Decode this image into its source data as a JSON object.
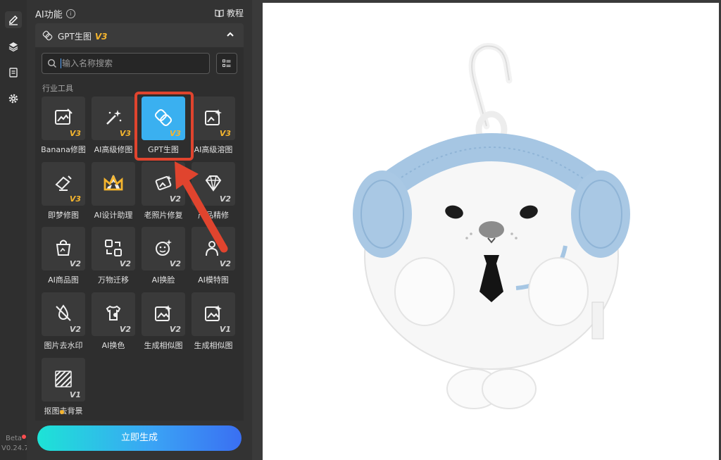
{
  "rail": {
    "items": [
      {
        "icon": "edit-icon",
        "active": true
      },
      {
        "icon": "layers-icon",
        "active": false
      },
      {
        "icon": "document-icon",
        "active": false
      },
      {
        "icon": "gear-icon",
        "active": false
      }
    ],
    "beta_label": "Beta",
    "version": "V0.24.7"
  },
  "panel": {
    "title": "AI功能",
    "tutorial_label": "教程",
    "section": {
      "label": "GPT生图",
      "version": "V3"
    },
    "search": {
      "placeholder": "输入名称搜索"
    },
    "category_label": "行业工具",
    "tools": [
      {
        "label": "Banana修图",
        "version": "V3",
        "gold": true,
        "icon": "image-edit-icon"
      },
      {
        "label": "AI高级修图",
        "version": "V3",
        "gold": true,
        "icon": "magic-wand-icon"
      },
      {
        "label": "GPT生图",
        "version": "V3",
        "gold": true,
        "icon": "gpt-knot-icon",
        "selected": true
      },
      {
        "label": "AI高级溶图",
        "version": "V3",
        "gold": true,
        "icon": "image-sparkle-icon"
      },
      {
        "label": "即梦修图",
        "version": "V3",
        "gold": true,
        "icon": "dream-edit-icon"
      },
      {
        "label": "AI设计助理",
        "version": "",
        "gold": false,
        "icon": "design-assistant-icon",
        "crown": true
      },
      {
        "label": "老照片修复",
        "version": "V2",
        "gold": false,
        "icon": "photo-restore-icon"
      },
      {
        "label": "产品精修",
        "version": "V2",
        "gold": false,
        "icon": "diamond-icon"
      },
      {
        "label": "AI商品图",
        "version": "V2",
        "gold": false,
        "icon": "shopping-bag-icon"
      },
      {
        "label": "万物迁移",
        "version": "V2",
        "gold": false,
        "icon": "transfer-icon"
      },
      {
        "label": "AI换脸",
        "version": "V2",
        "gold": false,
        "icon": "face-swap-icon"
      },
      {
        "label": "AI模特图",
        "version": "V2",
        "gold": false,
        "icon": "model-icon"
      },
      {
        "label": "图片去水印",
        "version": "V2",
        "gold": false,
        "icon": "remove-watermark-icon"
      },
      {
        "label": "AI换色",
        "version": "V2",
        "gold": false,
        "icon": "recolor-icon"
      },
      {
        "label": "生成相似图",
        "version": "V2",
        "gold": false,
        "icon": "similar-image-icon"
      },
      {
        "label": "生成相似图",
        "version": "V1",
        "gold": false,
        "icon": "similar-image-icon"
      },
      {
        "label": "抠图去背景",
        "version": "V1",
        "gold": false,
        "icon": "cutout-icon"
      }
    ],
    "generate_label": "立即生成"
  },
  "colors": {
    "accent": "#3ab0f0",
    "gold": "#f5b52e",
    "highlight": "#e0442e"
  }
}
